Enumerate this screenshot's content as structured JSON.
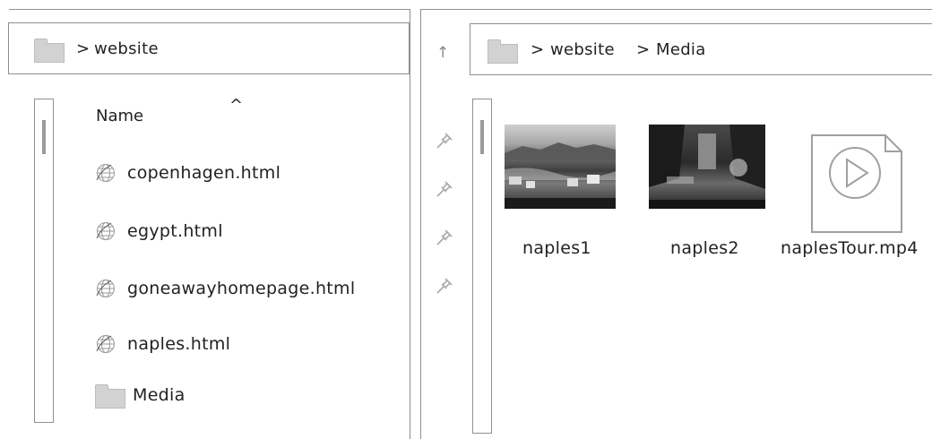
{
  "left": {
    "breadcrumb": {
      "separator": ">",
      "folder": "website"
    },
    "sort_indicator": "^",
    "column_header": "Name",
    "items": [
      {
        "name": "copenhagen.html",
        "icon": "html-globe-icon"
      },
      {
        "name": "egypt.html",
        "icon": "html-globe-icon"
      },
      {
        "name": "goneawayhomepage.html",
        "icon": "html-globe-icon"
      },
      {
        "name": "naples.html",
        "icon": "html-globe-icon"
      },
      {
        "name": "Media",
        "icon": "folder-icon"
      }
    ]
  },
  "right": {
    "up_arrow": "↑",
    "breadcrumb": {
      "sep1": ">",
      "folder1": "website",
      "sep2": ">",
      "folder2": "Media"
    },
    "files": [
      {
        "name": "naples1",
        "type": "image"
      },
      {
        "name": "naples2",
        "type": "image"
      },
      {
        "name": "naplesTour.mp4",
        "type": "video"
      }
    ]
  },
  "colors": {
    "border": "#8f8f8f",
    "folder": "#d2d2d2",
    "icon_stroke": "#9a9a9a"
  }
}
